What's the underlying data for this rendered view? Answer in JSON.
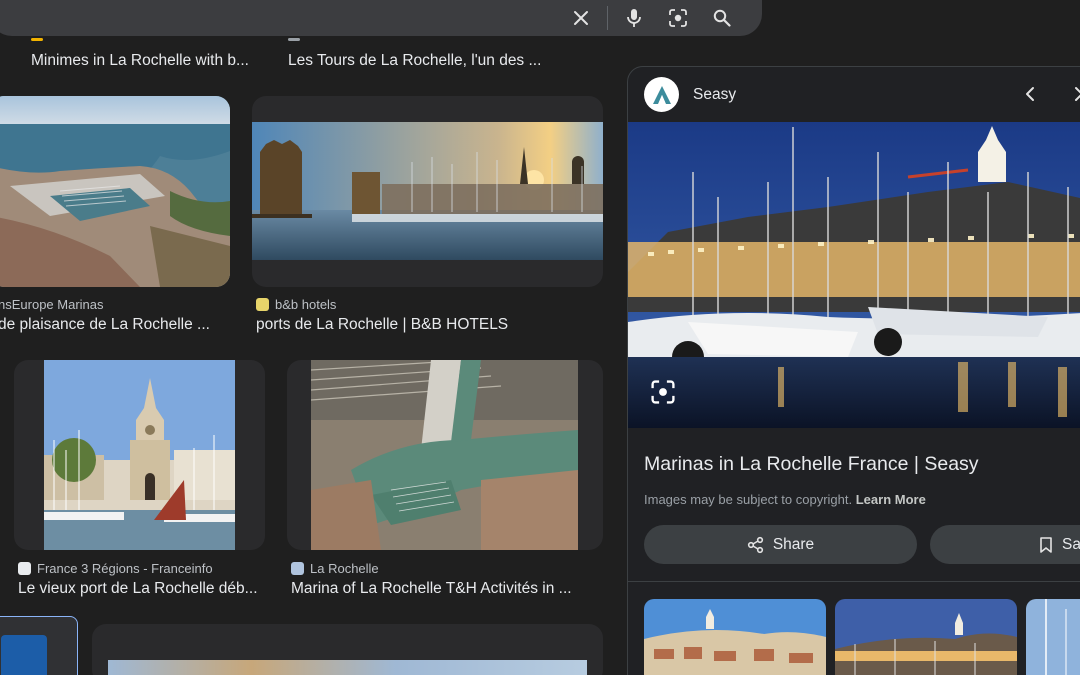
{
  "search": {
    "icons": [
      "clear-icon",
      "microphone-icon",
      "lens-icon",
      "search-icon"
    ]
  },
  "results": {
    "top_row": [
      {
        "title": "Minimes in La Rochelle with b..."
      },
      {
        "title": "Les Tours de La Rochelle, l'un des ..."
      }
    ],
    "row2": [
      {
        "source": "nsEurope Marinas",
        "title": "de plaisance de La Rochelle ..."
      },
      {
        "source": "b&b hotels",
        "title": "ports de La Rochelle | B&B HOTELS"
      }
    ],
    "row3": [
      {
        "source": "France 3 Régions - Franceinfo",
        "title": "Le vieux port de La Rochelle déb..."
      },
      {
        "source": "La Rochelle",
        "title": "Marina of La Rochelle T&H Activités in ..."
      }
    ]
  },
  "panel": {
    "site_name": "Seasy",
    "title": "Marinas in La Rochelle France | Seasy",
    "copyright_text": "Images may be subject to copyright.",
    "learn_more": "Learn More",
    "share_label": "Share",
    "save_label": "Save",
    "colors": {
      "accent_logo": "#3c8c9c",
      "panel_bg": "#202124",
      "button_bg": "#3c4043"
    }
  }
}
